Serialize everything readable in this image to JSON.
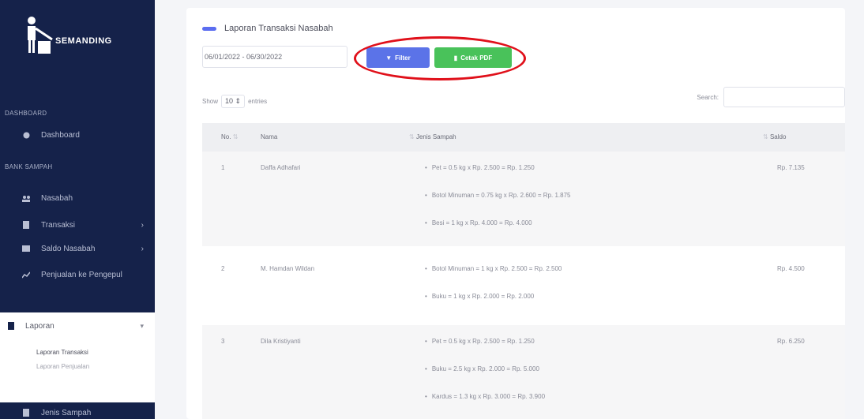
{
  "sidebar": {
    "brand": "SEMANDING",
    "section_dashboard": "DASHBOARD",
    "section_bank": "BANK SAMPAH",
    "items": [
      {
        "label": "Dashboard",
        "icon": "gauge-icon"
      },
      {
        "label": "Nasabah",
        "icon": "users-icon"
      },
      {
        "label": "Transaksi",
        "icon": "receipt-icon"
      },
      {
        "label": "Saldo Nasabah",
        "icon": "wallet-icon"
      },
      {
        "label": "Penjualan ke Pengepul",
        "icon": "chart-icon"
      },
      {
        "label": "Laporan",
        "icon": "book-icon"
      },
      {
        "label": "Jenis Sampah",
        "icon": "trash-icon"
      }
    ],
    "laporan_sub": [
      "Laporan Transaksi",
      "Laporan Penjualan"
    ]
  },
  "page": {
    "title": "Laporan Transaksi Nasabah",
    "date_range": "06/01/2022 - 06/30/2022",
    "filter_label": "Filter",
    "pdf_label": "Cetak PDF",
    "show_label": "Show",
    "entries_value": "10",
    "entries_label": "entries",
    "search_label": "Search:"
  },
  "table": {
    "headers": {
      "no": "No.",
      "nama": "Nama",
      "jenis": "Jenis Sampah",
      "saldo": "Saldo"
    },
    "rows": [
      {
        "no": "1",
        "nama": "Daffa Adhafari",
        "saldo": "Rp. 7.135",
        "items": [
          "Pet = 0.5 kg x Rp. 2.500 = Rp. 1.250",
          "Botol Minuman = 0.75 kg x Rp. 2.600 = Rp. 1.875",
          "Besi = 1 kg x Rp. 4.000 = Rp. 4.000"
        ]
      },
      {
        "no": "2",
        "nama": "M. Hamdan Wildan",
        "saldo": "Rp. 4.500",
        "items": [
          "Botol Minuman = 1 kg x Rp. 2.500 = Rp. 2.500",
          "Buku = 1 kg x Rp. 2.000 = Rp. 2.000"
        ]
      },
      {
        "no": "3",
        "nama": "Dila Kristiyanti",
        "saldo": "Rp. 6.250",
        "items": [
          "Pet = 0.5 kg x Rp. 2.500 = Rp. 1.250",
          "Buku = 2.5 kg x Rp. 2.000 = Rp. 5.000",
          "Kardus = 1.3 kg x Rp. 3.000 = Rp. 3.900"
        ]
      }
    ]
  },
  "colors": {
    "sidebar": "#15224a",
    "filter_button": "#5b73e8",
    "pdf_button": "#49c25a",
    "highlight": "#e0101a"
  }
}
